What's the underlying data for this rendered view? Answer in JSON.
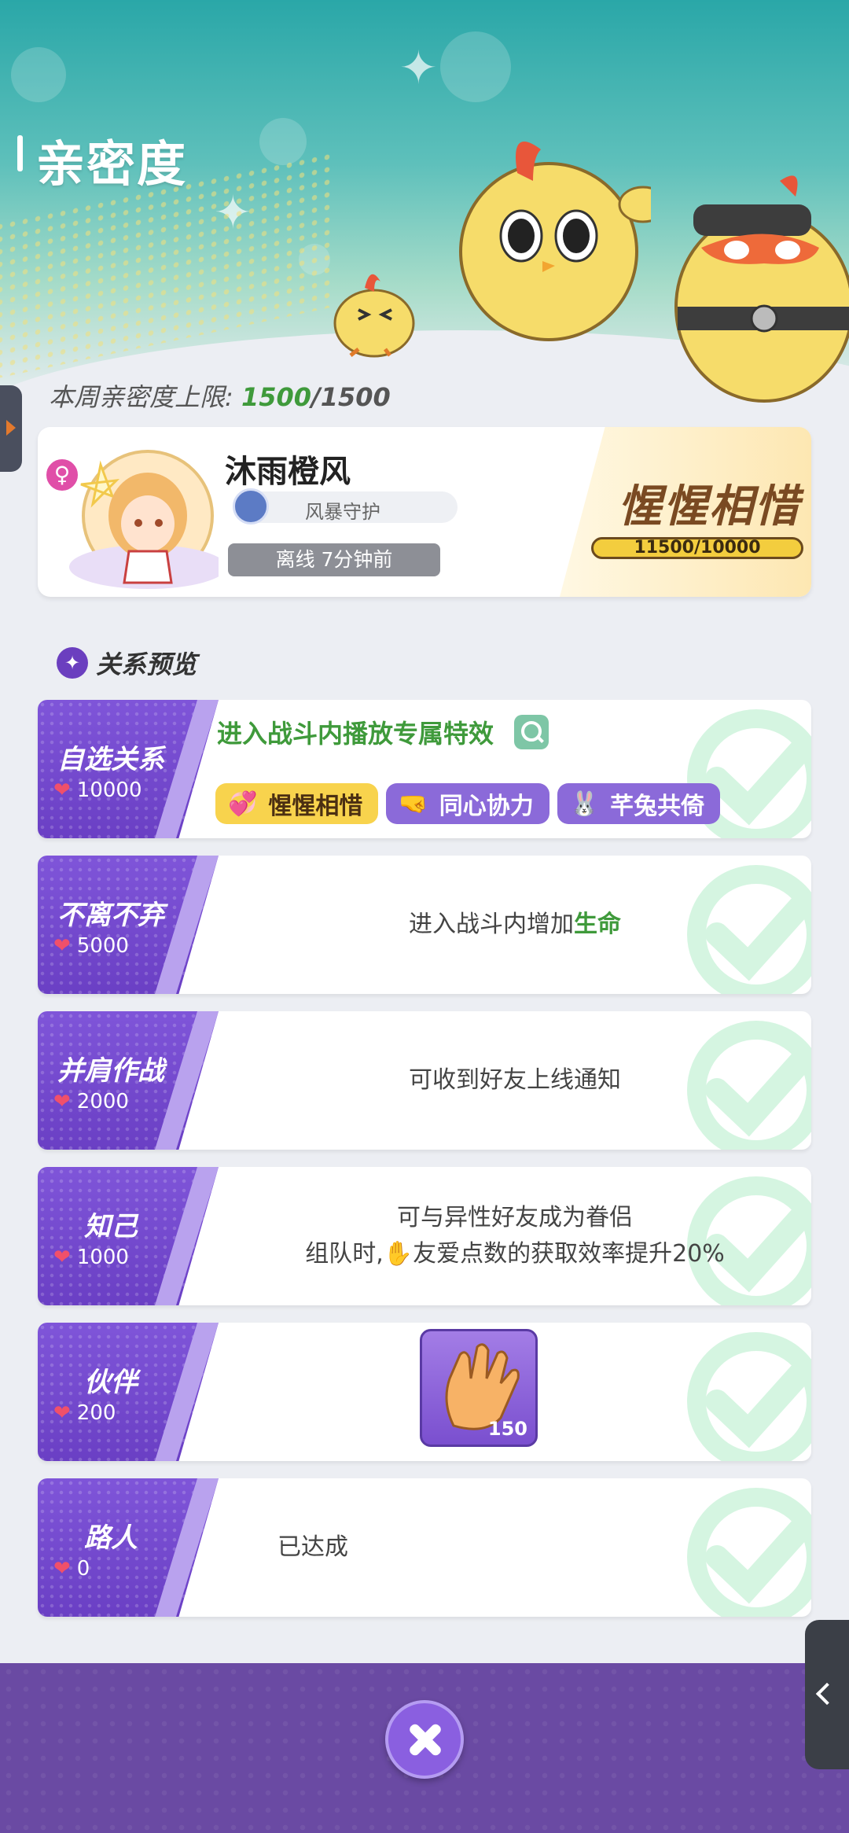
{
  "header": {
    "title": "亲密度",
    "weekly_label": "本周亲密度上限:",
    "weekly_current": "1500",
    "weekly_max": "/1500"
  },
  "friend": {
    "name": "沐雨橙风",
    "guild": "风暴守护",
    "status": "离线 7分钟前",
    "relationship": "惺惺相惜",
    "progress": "11500/10000",
    "gender_icon": "female-icon"
  },
  "section": {
    "label": "关系预览",
    "icon": "star-icon"
  },
  "tiers": [
    {
      "name": "自选关系",
      "req": "10000",
      "effect": "进入战斗内播放专属特效",
      "options": [
        "惺惺相惜",
        "同心协力",
        "芊兔共倚"
      ],
      "achieved": true
    },
    {
      "name": "不离不弃",
      "req": "5000",
      "desc_prefix": "进入战斗内增加",
      "desc_highlight": "生命",
      "achieved": true
    },
    {
      "name": "并肩作战",
      "req": "2000",
      "desc": "可收到好友上线通知",
      "achieved": true
    },
    {
      "name": "知己",
      "req": "1000",
      "desc_line1": "可与异性好友成为眷侣",
      "desc_line2_prefix": "组队时,",
      "desc_line2_suffix": "友爱点数的获取效率提升20%",
      "achieved": true
    },
    {
      "name": "伙伴",
      "req": "200",
      "reward_icon": "clap-hand-icon",
      "reward_count": "150",
      "achieved": true
    },
    {
      "name": "路人",
      "req": "0",
      "desc": "已达成",
      "achieved": true
    }
  ],
  "colors": {
    "accent_purple": "#6a3fc4",
    "highlight_green": "#3f9a3b",
    "heart_red": "#f0506a",
    "gold": "#f8d34d"
  }
}
